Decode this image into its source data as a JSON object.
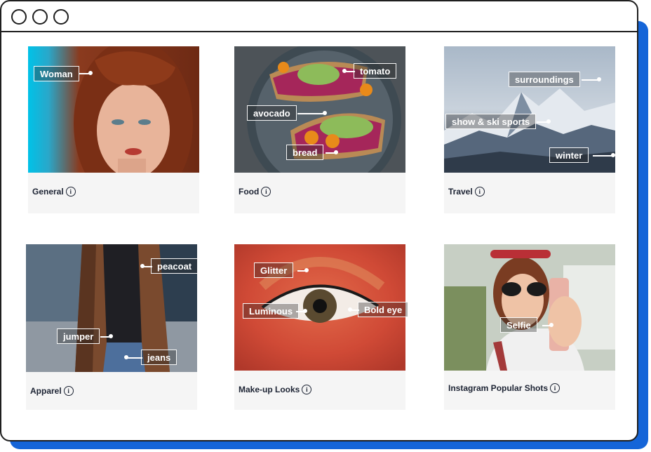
{
  "window": {
    "controls": [
      "close",
      "minimize",
      "maximize"
    ]
  },
  "cards": [
    {
      "caption": "General",
      "tags": [
        "Woman"
      ]
    },
    {
      "caption": "Food",
      "tags": [
        "tomato",
        "avocado",
        "bread"
      ]
    },
    {
      "caption": "Travel",
      "tags": [
        "surroundings",
        "show & ski sports",
        "winter"
      ]
    },
    {
      "caption": "Apparel",
      "tags": [
        "peacoat",
        "jumper",
        "jeans"
      ]
    },
    {
      "caption": "Make-up Looks",
      "tags": [
        "Glitter",
        "Luminous",
        "Bold eye"
      ]
    },
    {
      "caption": "Instagram Popular Shots",
      "tags": [
        "Selfie"
      ]
    }
  ],
  "colors": {
    "accent_shadow": "#1565d8",
    "card_bg": "#f5f5f5",
    "text": "#1c2333"
  },
  "icons": {
    "info": "info-circle-icon"
  }
}
